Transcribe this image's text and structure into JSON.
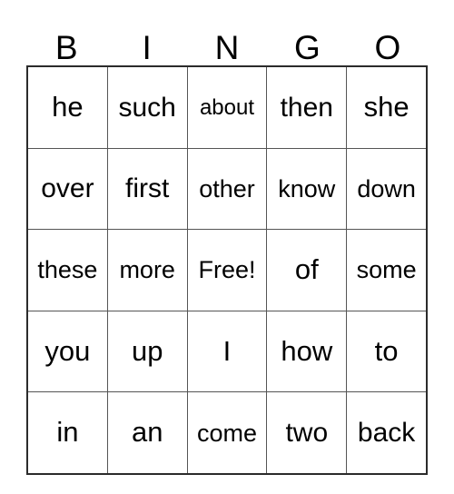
{
  "card": {
    "title": "BINGO",
    "header_letters": [
      "B",
      "I",
      "N",
      "G",
      "O"
    ],
    "free_space_label": "Free!",
    "colors": {
      "background": "#ffffff",
      "text": "#000000",
      "grid_outer_border": "#2b2b2b",
      "grid_inner_border": "#555555"
    },
    "grid": {
      "columns": 5,
      "rows": 5,
      "cells": [
        [
          {
            "text": "he",
            "size": "xl"
          },
          {
            "text": "such",
            "size": "lg"
          },
          {
            "text": "about",
            "size": "sm"
          },
          {
            "text": "then",
            "size": "lg"
          },
          {
            "text": "she",
            "size": "xl"
          }
        ],
        [
          {
            "text": "over",
            "size": "lg"
          },
          {
            "text": "first",
            "size": "lg"
          },
          {
            "text": "other",
            "size": "md"
          },
          {
            "text": "know",
            "size": "md"
          },
          {
            "text": "down",
            "size": "md"
          }
        ],
        [
          {
            "text": "these",
            "size": "md"
          },
          {
            "text": "more",
            "size": "md"
          },
          {
            "text": "Free!",
            "size": "md"
          },
          {
            "text": "of",
            "size": "xl"
          },
          {
            "text": "some",
            "size": "md"
          }
        ],
        [
          {
            "text": "you",
            "size": "xl"
          },
          {
            "text": "up",
            "size": "xl"
          },
          {
            "text": "I",
            "size": "xl"
          },
          {
            "text": "how",
            "size": "xl"
          },
          {
            "text": "to",
            "size": "xl"
          }
        ],
        [
          {
            "text": "in",
            "size": "xl"
          },
          {
            "text": "an",
            "size": "xl"
          },
          {
            "text": "come",
            "size": "md"
          },
          {
            "text": "two",
            "size": "lg"
          },
          {
            "text": "back",
            "size": "lg"
          }
        ]
      ]
    }
  }
}
